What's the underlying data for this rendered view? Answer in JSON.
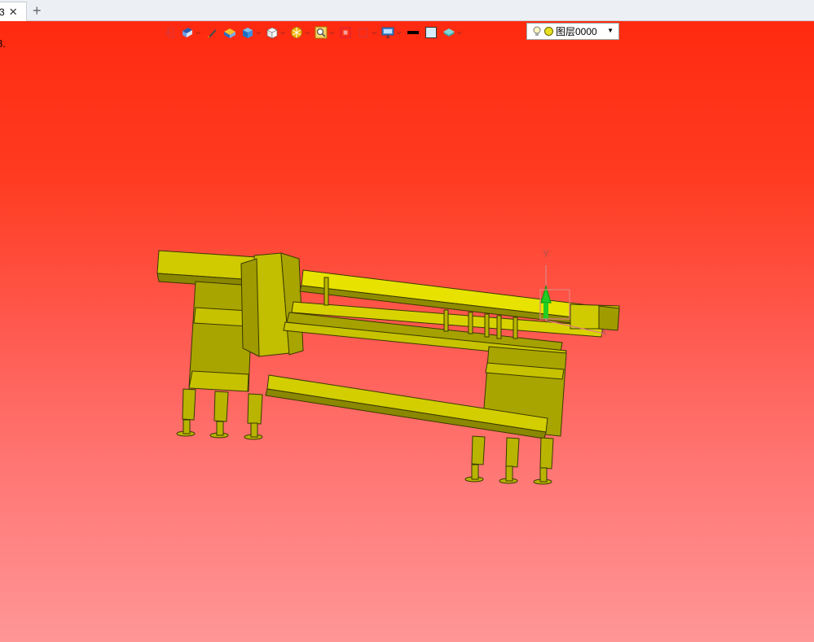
{
  "tabs": [
    {
      "label": "3",
      "close": "✕"
    }
  ],
  "add_tab": "+",
  "edge_text": "8.",
  "toolbar": {
    "items": [
      {
        "icon": "exit-icon",
        "has_dropdown": false
      },
      {
        "icon": "view-orientation-icon",
        "has_dropdown": true
      },
      {
        "icon": "pen-icon",
        "has_dropdown": false
      },
      {
        "icon": "shaded-solid-icon",
        "has_dropdown": false
      },
      {
        "icon": "cube-blue-icon",
        "has_dropdown": true
      },
      {
        "icon": "cube-white-icon",
        "has_dropdown": true
      },
      {
        "icon": "section-icon",
        "has_dropdown": true
      },
      {
        "icon": "zoom-icon",
        "has_dropdown": true
      },
      {
        "icon": "fit-view-icon",
        "has_dropdown": false
      },
      {
        "icon": "dimension-icon",
        "has_dropdown": true
      },
      {
        "icon": "display-monitor-icon",
        "has_dropdown": true
      },
      {
        "icon": "line-color-icon",
        "has_dropdown": false
      },
      {
        "icon": "fill-color-icon",
        "has_dropdown": false
      },
      {
        "icon": "layer-stack-icon",
        "has_dropdown": true
      }
    ],
    "dropdown_arrow": "⌄"
  },
  "layer": {
    "label": "图层0000",
    "bulb_icon": "lightbulb-icon",
    "dot_color": "#e6e020",
    "caret": "▼"
  },
  "viewport": {
    "gradient_top": "#ff2a10",
    "gradient_bottom": "#ff9696",
    "model_color": "#b8b400",
    "axis_label": "Y",
    "axis_x_label": "X"
  }
}
